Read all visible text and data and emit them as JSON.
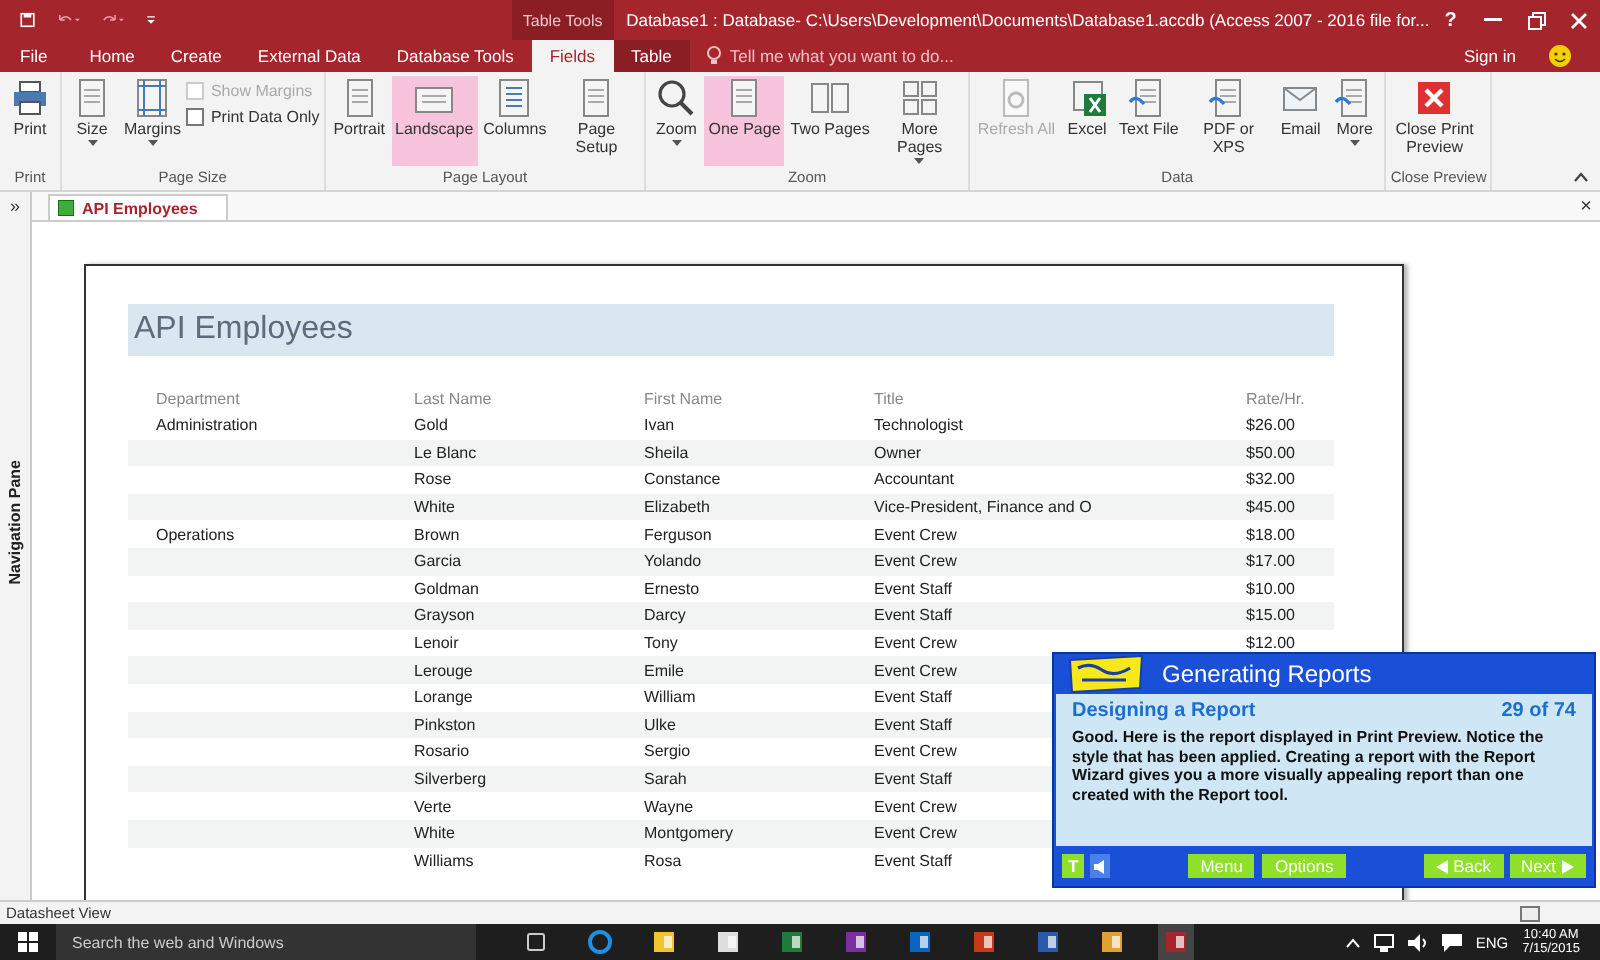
{
  "titlebar": {
    "context_label": "Table Tools",
    "title": "Database1 : Database- C:\\Users\\Development\\Documents\\Database1.accdb (Access 2007 - 2016 file for...",
    "help": "?"
  },
  "tabs": [
    {
      "label": "File",
      "selected": false
    },
    {
      "label": "Home",
      "selected": false
    },
    {
      "label": "Create",
      "selected": false
    },
    {
      "label": "External Data",
      "selected": false
    },
    {
      "label": "Database Tools",
      "selected": false
    },
    {
      "label": "Fields",
      "selected": true
    },
    {
      "label": "Table",
      "selected": false
    }
  ],
  "tell_me": {
    "placeholder": "Tell me what you want to do..."
  },
  "sign_in": "Sign in",
  "ribbon": [
    {
      "label": "Print",
      "buttons": [
        {
          "kind": "large",
          "label": "Print",
          "dropdown": false,
          "selected": false,
          "disabled": false
        }
      ]
    },
    {
      "label": "Page Size",
      "buttons": [
        {
          "kind": "large",
          "label": "Size",
          "dropdown": true,
          "selected": false,
          "disabled": false
        },
        {
          "kind": "large",
          "label": "Margins",
          "dropdown": true,
          "selected": false,
          "disabled": false
        },
        {
          "kind": "check",
          "label": "Show Margins",
          "checked": false,
          "disabled": true
        },
        {
          "kind": "check",
          "label": "Print Data Only",
          "checked": false,
          "disabled": false
        }
      ]
    },
    {
      "label": "Page Layout",
      "buttons": [
        {
          "kind": "large",
          "label": "Portrait",
          "dropdown": false,
          "selected": false,
          "disabled": false
        },
        {
          "kind": "large",
          "label": "Landscape",
          "dropdown": false,
          "selected": true,
          "disabled": false
        },
        {
          "kind": "large",
          "label": "Columns",
          "dropdown": false,
          "selected": false,
          "disabled": false
        },
        {
          "kind": "large",
          "label": "Page Setup",
          "dropdown": false,
          "selected": false,
          "disabled": false
        }
      ]
    },
    {
      "label": "Zoom",
      "buttons": [
        {
          "kind": "large",
          "label": "Zoom",
          "dropdown": true,
          "selected": false,
          "disabled": false
        },
        {
          "kind": "large",
          "label": "One Page",
          "dropdown": false,
          "selected": true,
          "disabled": false
        },
        {
          "kind": "large",
          "label": "Two Pages",
          "dropdown": false,
          "selected": false,
          "disabled": false
        },
        {
          "kind": "large",
          "label": "More Pages",
          "dropdown": true,
          "selected": false,
          "disabled": false
        }
      ]
    },
    {
      "label": "Data",
      "buttons": [
        {
          "kind": "large",
          "label": "Refresh All",
          "dropdown": false,
          "selected": false,
          "disabled": true
        },
        {
          "kind": "large",
          "label": "Excel",
          "dropdown": false,
          "selected": false,
          "disabled": false
        },
        {
          "kind": "large",
          "label": "Text File",
          "dropdown": false,
          "selected": false,
          "disabled": false
        },
        {
          "kind": "large",
          "label": "PDF or XPS",
          "dropdown": false,
          "selected": false,
          "disabled": false
        },
        {
          "kind": "large",
          "label": "Email",
          "dropdown": false,
          "selected": false,
          "disabled": false
        },
        {
          "kind": "large",
          "label": "More",
          "dropdown": true,
          "selected": false,
          "disabled": false
        }
      ]
    },
    {
      "label": "Close Preview",
      "buttons": [
        {
          "kind": "large",
          "label": "Close Print Preview",
          "dropdown": false,
          "selected": false,
          "disabled": false
        }
      ]
    }
  ],
  "nav_pane": {
    "toggle": "»",
    "label": "Navigation Pane"
  },
  "doc_tab": {
    "label": "API Employees",
    "close": "×"
  },
  "report": {
    "title": "API Employees",
    "columns": [
      "Department",
      "Last Name",
      "First Name",
      "Title",
      "Rate/Hr."
    ],
    "rows": [
      {
        "department": "Administration",
        "last": "Gold",
        "first": "Ivan",
        "title": "Technologist",
        "rate": "$26.00"
      },
      {
        "last": "Le Blanc",
        "first": "Sheila",
        "title": "Owner",
        "rate": "$50.00"
      },
      {
        "last": "Rose",
        "first": "Constance",
        "title": "Accountant",
        "rate": "$32.00"
      },
      {
        "last": "White",
        "first": "Elizabeth",
        "title": "Vice-President, Finance and O",
        "rate": "$45.00"
      },
      {
        "department": "Operations",
        "last": "Brown",
        "first": "Ferguson",
        "title": "Event Crew",
        "rate": "$18.00"
      },
      {
        "last": "Garcia",
        "first": "Yolando",
        "title": "Event Crew",
        "rate": "$17.00"
      },
      {
        "last": "Goldman",
        "first": "Ernesto",
        "title": "Event Staff",
        "rate": "$10.00"
      },
      {
        "last": "Grayson",
        "first": "Darcy",
        "title": "Event Staff",
        "rate": "$15.00"
      },
      {
        "last": "Lenoir",
        "first": "Tony",
        "title": "Event Crew",
        "rate": "$12.00"
      },
      {
        "last": "Lerouge",
        "first": "Emile",
        "title": "Event Crew"
      },
      {
        "last": "Lorange",
        "first": "William",
        "title": "Event Staff"
      },
      {
        "last": "Pinkston",
        "first": "Ulke",
        "title": "Event Staff"
      },
      {
        "last": "Rosario",
        "first": "Sergio",
        "title": "Event Crew"
      },
      {
        "last": "Silverberg",
        "first": "Sarah",
        "title": "Event Staff"
      },
      {
        "last": "Verte",
        "first": "Wayne",
        "title": "Event Crew"
      },
      {
        "last": "White",
        "first": "Montgomery",
        "title": "Event Crew"
      },
      {
        "last": "Williams",
        "first": "Rosa",
        "title": "Event Staff"
      }
    ]
  },
  "status_bar": "Datasheet View",
  "tutor": {
    "title": "Generating Reports",
    "lesson": "Designing a Report",
    "progress": "29 of 74",
    "text": "Good. Here is the report displayed in Print Preview. Notice the style that has been applied. Creating a report with the Report Wizard gives you a more visually appealing report than one created with the Report tool.",
    "text_button": "T",
    "buttons": [
      "Menu",
      "Options"
    ],
    "back": "Back",
    "next": "Next"
  },
  "taskbar": {
    "search": {
      "placeholder": "Search the web and Windows"
    },
    "language": "ENG",
    "time": "10:40 AM",
    "date": "7/15/2015"
  }
}
